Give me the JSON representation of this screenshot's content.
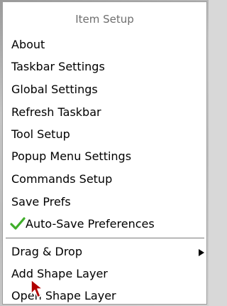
{
  "menu": {
    "title": "Item Setup",
    "items": [
      {
        "label": "About"
      },
      {
        "label": "Taskbar Settings"
      },
      {
        "label": "Global Settings"
      },
      {
        "label": "Refresh Taskbar"
      },
      {
        "label": "Tool Setup"
      },
      {
        "label": "Popup Menu Settings"
      },
      {
        "label": "Commands Setup"
      },
      {
        "label": "Save Prefs"
      },
      {
        "label": "Auto-Save Preferences",
        "checked": true,
        "check_icon": "checkmark-icon",
        "check_color": "#3fae2a"
      }
    ],
    "items_after_separator": [
      {
        "label": "Drag & Drop",
        "submenu_icon": "submenu-arrow-icon"
      },
      {
        "label": "Add Shape Layer"
      },
      {
        "label": "Open Shape Layer"
      }
    ]
  },
  "cursor": {
    "icon": "mouse-pointer-icon",
    "color": "#b00000"
  }
}
